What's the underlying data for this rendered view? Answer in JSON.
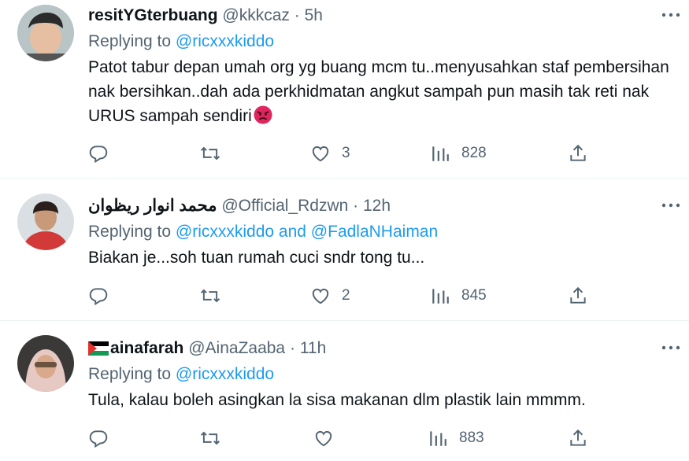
{
  "tweets": [
    {
      "name": "resitYGterbuang",
      "handle": "@kkkcaz",
      "time": "5h",
      "replying_label": "Replying to",
      "replying_to": "@ricxxxkiddo",
      "text": "Patot tabur depan umah org yg buang mcm tu..menyusahkan staf pembersihan nak bersihkan..dah ada perkhidmatan angkut sampah pun masih tak reti nak URUS sampah sendiri",
      "emoji": "angry-face-icon",
      "likes": "3",
      "views": "828"
    },
    {
      "name": "محمد انوار ريظوان",
      "handle": "@Official_Rdzwn",
      "time": "12h",
      "replying_label": "Replying to",
      "replying_to": "@ricxxxkiddo and @FadlaNHaiman",
      "text": "Biakan je...soh tuan rumah cuci sndr tong tu...",
      "likes": "2",
      "views": "845"
    },
    {
      "name": "ainafarah",
      "handle": "@AinaZaaba",
      "time": "11h",
      "replying_label": "Replying to",
      "replying_to": "@ricxxxkiddo",
      "text": "Tula, kalau boleh asingkan la sisa makanan dlm plastik lain mmmm.",
      "name_flag": "palestine-flag-icon",
      "likes": "",
      "views": "883"
    }
  ],
  "colors": {
    "link": "#1d9bf0",
    "muted": "#536471",
    "text": "#0f1419",
    "divider": "#eff3f4",
    "angry": "#e0245e"
  },
  "icons": [
    "reply-icon",
    "retweet-icon",
    "like-icon",
    "views-icon",
    "share-icon",
    "more-icon"
  ]
}
